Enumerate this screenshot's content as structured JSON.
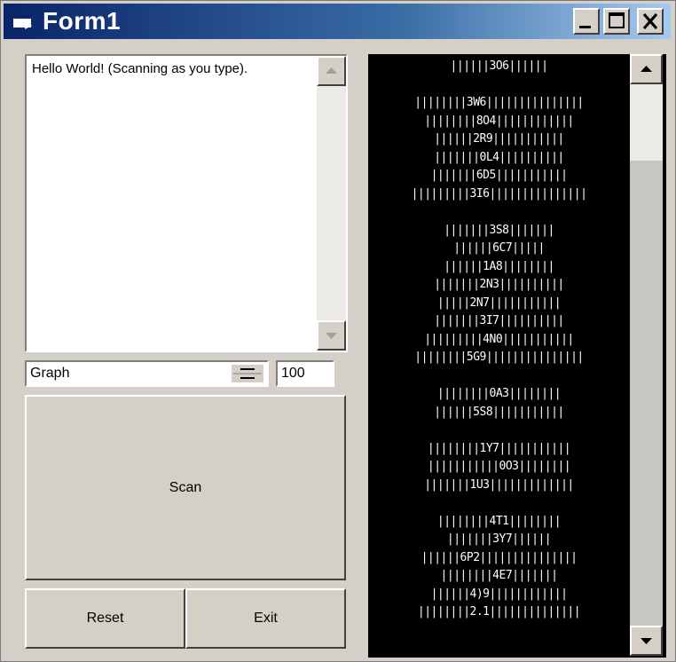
{
  "window": {
    "title": "Form1",
    "controls": {
      "minimize": "minimize",
      "maximize": "maximize",
      "close": "close"
    }
  },
  "input_text": "Hello World! (Scanning as you type).",
  "symbology": {
    "selected": "Graph"
  },
  "size_value": "100",
  "buttons": {
    "scan": "Scan",
    "reset": "Reset",
    "exit": "Exit"
  },
  "output_lines": [
    "||||||3O6||||||",
    "",
    "||||||||3W6|||||||||||||||",
    "||||||||8O4||||||||||||",
    "||||||2R9|||||||||||",
    "|||||||0L4||||||||||",
    "|||||||6D5|||||||||||",
    "|||||||||3I6|||||||||||||||",
    "",
    "|||||||3S8|||||||",
    "||||||6C7|||||",
    "||||||1A8||||||||",
    "|||||||2N3||||||||||",
    "|||||2N7|||||||||||",
    "|||||||3I7||||||||||",
    "|||||||||4N0|||||||||||",
    "||||||||5G9|||||||||||||||",
    "",
    "||||||||0A3||||||||",
    "||||||5S8|||||||||||",
    "",
    "||||||||1Y7|||||||||||",
    "|||||||||||0O3||||||||",
    "|||||||1U3|||||||||||||",
    "",
    "||||||||4T1||||||||",
    "|||||||3Y7||||||",
    "||||||6P2|||||||||||||||",
    "||||||||4E7|||||||",
    "||||||4)9||||||||||||",
    "||||||||2.1||||||||||||||"
  ],
  "icons": {
    "app": "form-icon",
    "scroll_up": "arrow-up-icon",
    "scroll_down": "arrow-down-icon",
    "spin": "spin-updown-icon"
  }
}
